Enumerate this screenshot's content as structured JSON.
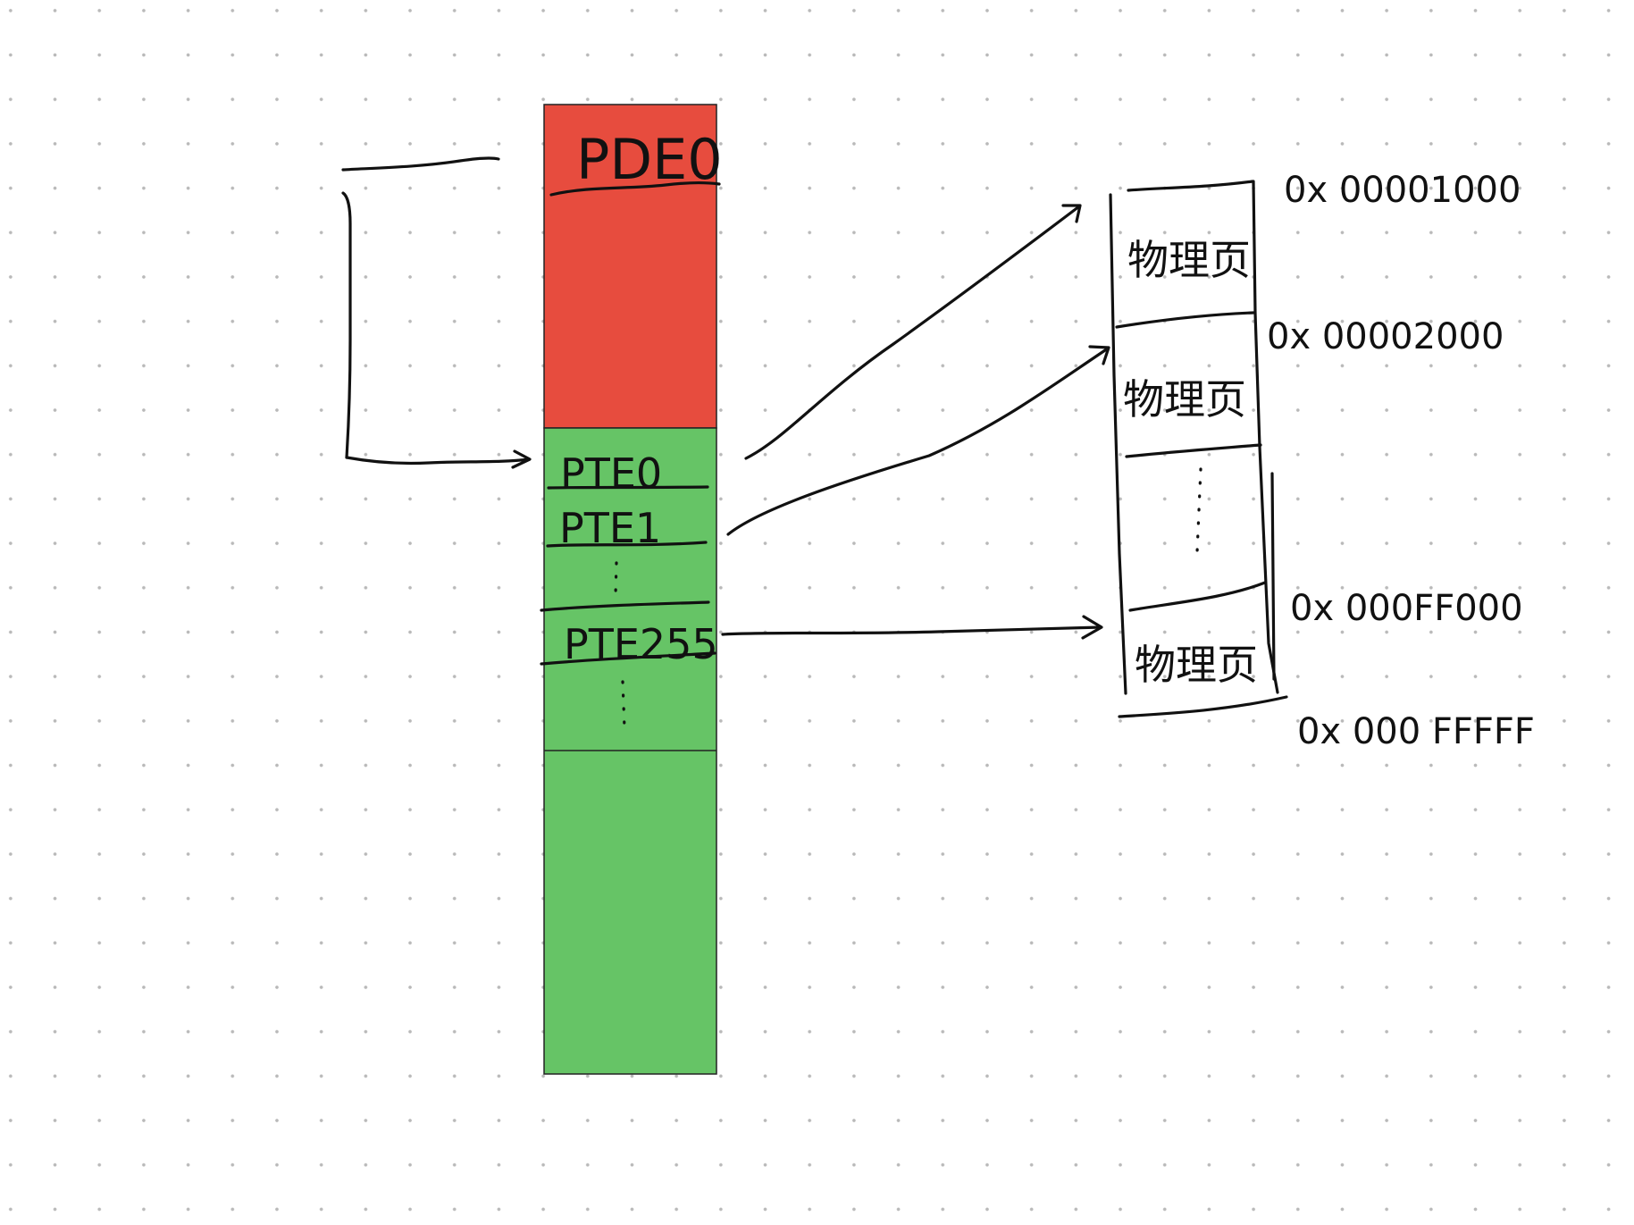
{
  "colors": {
    "page_directory": "#e74c3e",
    "page_table": "#66c466",
    "ink": "#111111",
    "grid_dot": "#b9b9b9"
  },
  "page_directory": {
    "entry_label": "PDE0"
  },
  "page_table": {
    "entries": [
      "PTE0",
      "PTE1",
      "PTE255"
    ]
  },
  "physical_memory": {
    "page_label": "物理页",
    "addresses": [
      "0x 00001000",
      "0x 00002000",
      "0x 000FF000",
      "0x 000 FFFFF"
    ]
  }
}
